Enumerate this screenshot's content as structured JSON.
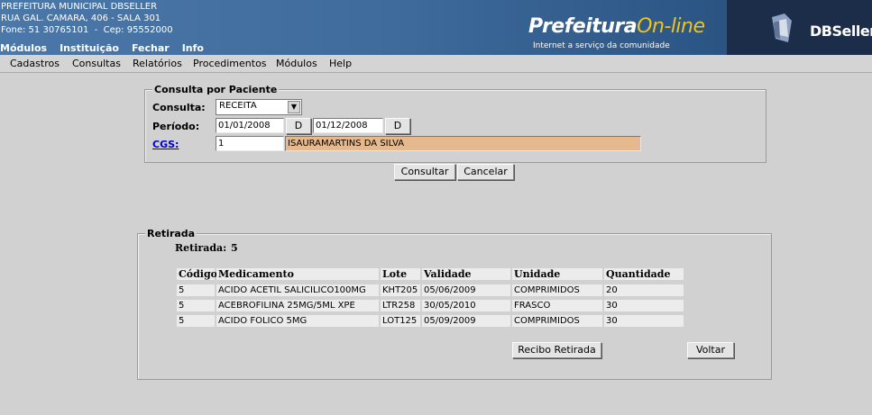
{
  "header": {
    "org_name": "PREFEITURA MUNICIPAL DBSELLER",
    "address": "RUA GAL. CAMARA, 406 - SALA 301",
    "phone": "Fone: 51 30765101  -  Cep: 95552000",
    "top_menu": [
      "Módulos",
      "Instituição",
      "Fechar",
      "Info"
    ],
    "logo_main": "Prefeitura",
    "logo_online": "On-line",
    "logo_tagline": "Internet a serviço da comunidade",
    "brand": "DBSeller"
  },
  "menubar": [
    "Cadastros",
    "Consultas",
    "Relatórios",
    "Procedimentos",
    "Módulos",
    "Help"
  ],
  "consulta": {
    "legend": "Consulta por Paciente",
    "consulta_label": "Consulta:",
    "consulta_value": "RECEITA",
    "periodo_label": "Período:",
    "data_inicio": "01/01/2008",
    "data_fim": "01/12/2008",
    "date_button": "D",
    "cgs_label": "CGS:",
    "cgs_value": "1",
    "paciente_nome": "ISAURAMARTINS DA SILVA",
    "btn_consultar": "Consultar",
    "btn_cancelar": "Cancelar"
  },
  "retirada": {
    "legend": "Retirada",
    "count_label": "Retirada:",
    "count_value": "5",
    "columns": [
      "Código",
      "Medicamento",
      "Lote",
      "Validade",
      "Unidade",
      "Quantidade"
    ],
    "rows": [
      [
        "5",
        "ACIDO ACETIL SALICILICO100MG",
        "KHT205",
        "05/06/2009",
        "COMPRIMIDOS",
        "20"
      ],
      [
        "5",
        "ACEBROFILINA 25MG/5ML XPE",
        "LTR258",
        "30/05/2010",
        "FRASCO",
        "30"
      ],
      [
        "5",
        "ACIDO FOLICO 5MG",
        "LOT125",
        "05/09/2009",
        "COMPRIMIDOS",
        "30"
      ]
    ],
    "btn_recibo": "Recibo Retirada",
    "btn_voltar": "Voltar"
  }
}
